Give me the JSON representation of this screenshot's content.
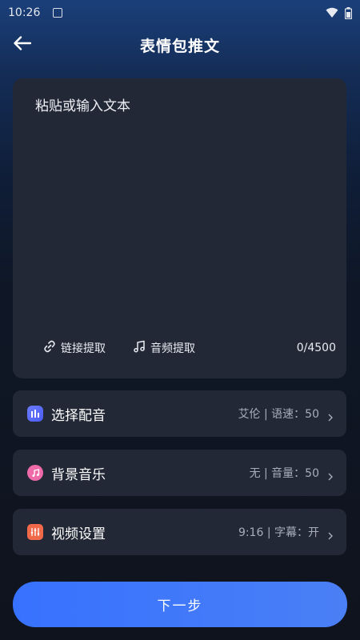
{
  "status_bar": {
    "time": "10:26"
  },
  "header": {
    "title": "表情包推文"
  },
  "text_card": {
    "placeholder": "粘贴或输入文本",
    "value": "",
    "link_extract_label": "链接提取",
    "audio_extract_label": "音频提取",
    "char_count": "0/4500"
  },
  "settings": {
    "voice": {
      "label": "选择配音",
      "value": "艾伦 | 语速：50",
      "icon": "voice-bars-icon",
      "color": "#5a6cf5"
    },
    "music": {
      "label": "背景音乐",
      "value": "无 | 音量：50",
      "icon": "music-note-icon",
      "color": "#ef6aa8"
    },
    "video": {
      "label": "视频设置",
      "value": "9:16 | 字幕：开",
      "icon": "equalizer-sliders-icon",
      "color": "#f06a4a"
    }
  },
  "next_button": {
    "label": "下一步"
  },
  "colors": {
    "accent": "#3772ff",
    "card": "#232836",
    "background": "#0f131d"
  }
}
